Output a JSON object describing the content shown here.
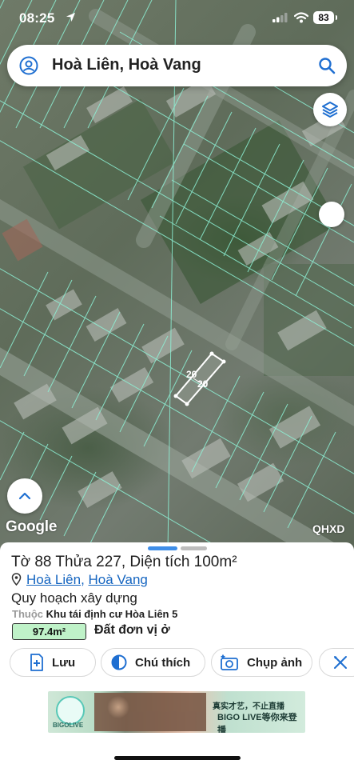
{
  "status_bar": {
    "time": "08:25",
    "battery": "83"
  },
  "search": {
    "query": "Hoà Liên, Hoà Vang"
  },
  "map": {
    "attribution": "Google",
    "layer_badge": "QHXD",
    "plot_labels": [
      "20",
      "20"
    ]
  },
  "sheet": {
    "title": "Tờ 88 Thửa 227, Diện tích 100m²",
    "location": {
      "ward": "Hoà Liên",
      "separator": ", ",
      "district": "Hoà Vang"
    },
    "planning_title": "Quy hoạch xây dựng",
    "belongs_label": "Thuộc",
    "belongs_value": "Khu tái định cư Hòa Liên 5",
    "area": "97.4m²",
    "land_type": "Đất đơn vị ở",
    "actions": {
      "save": "Lưu",
      "legend": "Chú thích",
      "photo": "Chụp ảnh"
    }
  },
  "ad": {
    "brand_small": "BIGOLIVE",
    "slogan": "真实才艺，不止直播",
    "brand_large": "BIGO LIVE等你来登播"
  },
  "colors": {
    "accent": "#1565c0",
    "area_chip": "#bff2c8",
    "parcel_lines": "#8ef2d6",
    "selected_parcel": "#ffffff"
  }
}
